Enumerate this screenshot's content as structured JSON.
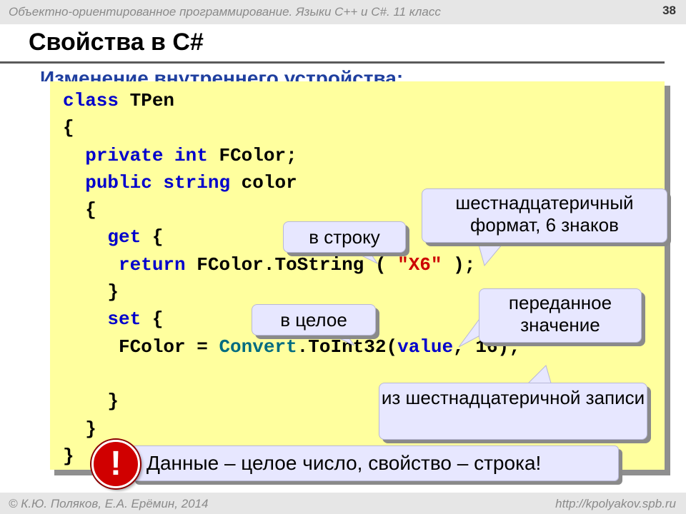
{
  "header": {
    "course": "Объектно-ориентированное программирование. Языки С++ и С#. 11 класс",
    "page_number": "38"
  },
  "title": "Свойства в C#",
  "subtitle": "Изменение внутреннего устройства:",
  "code": {
    "l1_kw": "class",
    "l1_rest": " TPen",
    "l2": "{",
    "l3_kw": "private int",
    "l3_rest": " FColor;",
    "l4_kw": "public string",
    "l4_rest": " color",
    "l5": "{",
    "l6_kw": "get",
    "l6_rest": " {",
    "l7_kw": "return",
    "l7_a": " FColor.ToString ( ",
    "l7_str": "\"X6\"",
    "l7_b": " );",
    "l8": "}",
    "l9_kw": "set",
    "l9_rest": " {",
    "l10_a": "FColor",
    "l10_op": " = ",
    "l10_conv": "Convert",
    "l10_b": ".ToInt32(",
    "l10_val": "value",
    "l10_c": ", 16);",
    "l12": "}",
    "l13": "}",
    "l14": "}"
  },
  "callouts": {
    "to_string": "в строку",
    "hex_format": "шестнадцатеричный формат, 6 знаков",
    "to_int": "в целое",
    "passed_value": "переданное значение",
    "from_hex": "из шестнадцатеричной записи"
  },
  "banner": {
    "icon": "!",
    "text": "Данные – целое число, свойство – строка!"
  },
  "footer": {
    "author": "© К.Ю. Поляков, Е.А. Ерёмин, 2014",
    "url": "http://kpolyakov.spb.ru"
  }
}
